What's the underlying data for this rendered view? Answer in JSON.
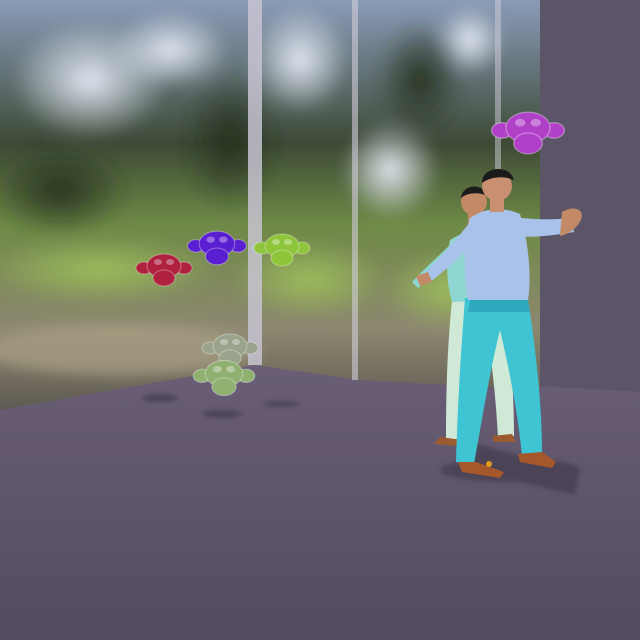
{
  "scene": {
    "colors": {
      "floor_near": "#574e63",
      "floor_far": "#675c73",
      "right_wall": "#5a5466",
      "back_wall": "#4b4656",
      "foliage_dark": "#2d3a26",
      "foliage_light": "#7a9a4a",
      "sky_light": "#cfd7e6",
      "glass_frame": "#b9b6c4"
    },
    "objects": [
      {
        "name": "monkey-head-red",
        "kind": "monkey-head",
        "color": "#b0203f"
      },
      {
        "name": "monkey-head-violet",
        "kind": "monkey-head",
        "color": "#5a1fd0"
      },
      {
        "name": "monkey-head-green",
        "kind": "monkey-head",
        "color": "#8ec53a"
      },
      {
        "name": "monkey-head-magenta",
        "kind": "monkey-head",
        "color": "#b040c8"
      },
      {
        "name": "monkey-head-glass-top",
        "kind": "monkey-head",
        "color": "#9aa38c"
      },
      {
        "name": "monkey-head-glass-bottom",
        "kind": "monkey-head",
        "color": "#8fb070"
      },
      {
        "name": "figure-dancer-front",
        "kind": "human-figure",
        "shirt_color": "#a9c2ea",
        "pants_color": "#3ec4d2",
        "shoe_color": "#a4582c"
      },
      {
        "name": "figure-dancer-back",
        "kind": "human-figure",
        "shirt_color": "#8fd6d2",
        "pants_color": "#cfe9d6",
        "shoe_color": "#9c5a30"
      }
    ]
  }
}
